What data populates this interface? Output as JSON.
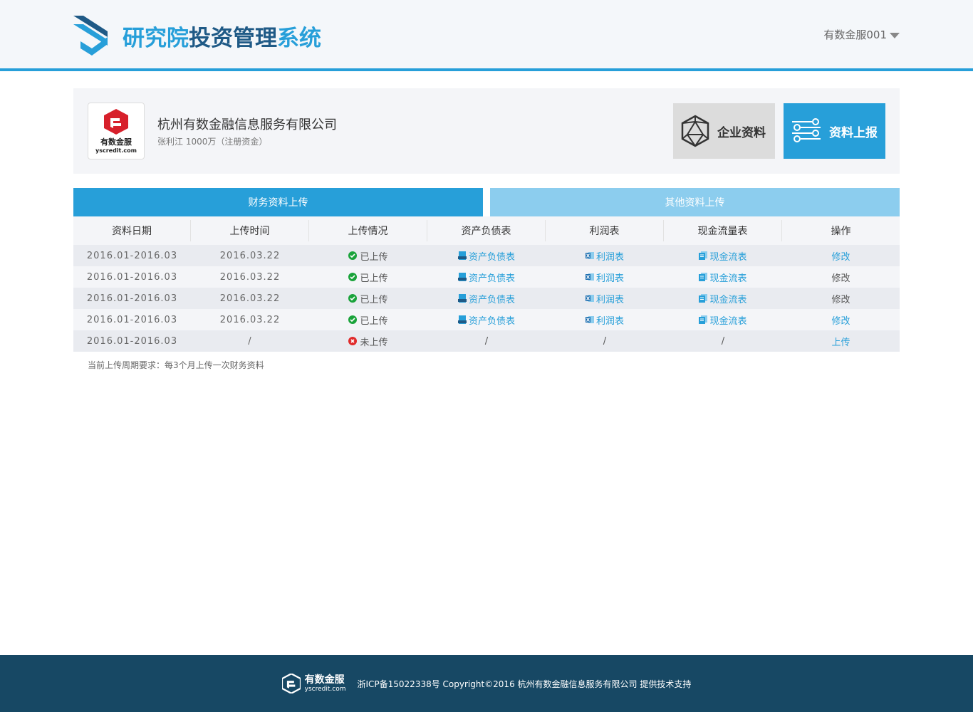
{
  "header": {
    "title_part1": "研究院",
    "title_part2": "投资管理",
    "title_part3": "系统",
    "user_name": "有数金服001"
  },
  "company": {
    "logo_cn": "有数金服",
    "logo_en": "yscredit.com",
    "name": "杭州有数金融信息服务有限公司",
    "subtitle": "张利江 1000万（注册资金）",
    "btn_info": "企业资料",
    "btn_upload": "资料上报"
  },
  "tabs": {
    "financial": "财务资料上传",
    "other": "其他资料上传"
  },
  "table": {
    "headers": [
      "资料日期",
      "上传时间",
      "上传情况",
      "资产负债表",
      "利润表",
      "现金流量表",
      "操作"
    ],
    "rows": [
      {
        "date": "2016.01-2016.03",
        "upload_time": "2016.03.22",
        "status": "已上传",
        "balance": "资产负债表",
        "profit": "利润表",
        "cash": "现金流表",
        "op": "修改"
      },
      {
        "date": "2016.01-2016.03",
        "upload_time": "2016.03.22",
        "status": "已上传",
        "balance": "资产负债表",
        "profit": "利润表",
        "cash": "现金流表",
        "op": "修改"
      },
      {
        "date": "2016.01-2016.03",
        "upload_time": "2016.03.22",
        "status": "已上传",
        "balance": "资产负债表",
        "profit": "利润表",
        "cash": "现金流表",
        "op": "修改"
      },
      {
        "date": "2016.01-2016.03",
        "upload_time": "2016.03.22",
        "status": "已上传",
        "balance": "资产负债表",
        "profit": "利润表",
        "cash": "现金流表",
        "op": "修改"
      },
      {
        "date": "2016.01-2016.03",
        "upload_time": "/",
        "status": "未上传",
        "balance": "/",
        "profit": "/",
        "cash": "/",
        "op": "上传"
      }
    ]
  },
  "note": "当前上传周期要求：每3个月上传一次财务资料",
  "footer": {
    "logo_cn": "有数金服",
    "logo_en": "yscredit.com",
    "copyright": "浙ICP备15022338号 Copyright©2016 杭州有数金融信息服务有限公司 提供技术支持"
  },
  "colors": {
    "accent": "#279fd9",
    "accent_light": "#8ccdee",
    "footer_bg": "#174864",
    "ok": "#1aa33b",
    "error": "#e02b2b"
  }
}
